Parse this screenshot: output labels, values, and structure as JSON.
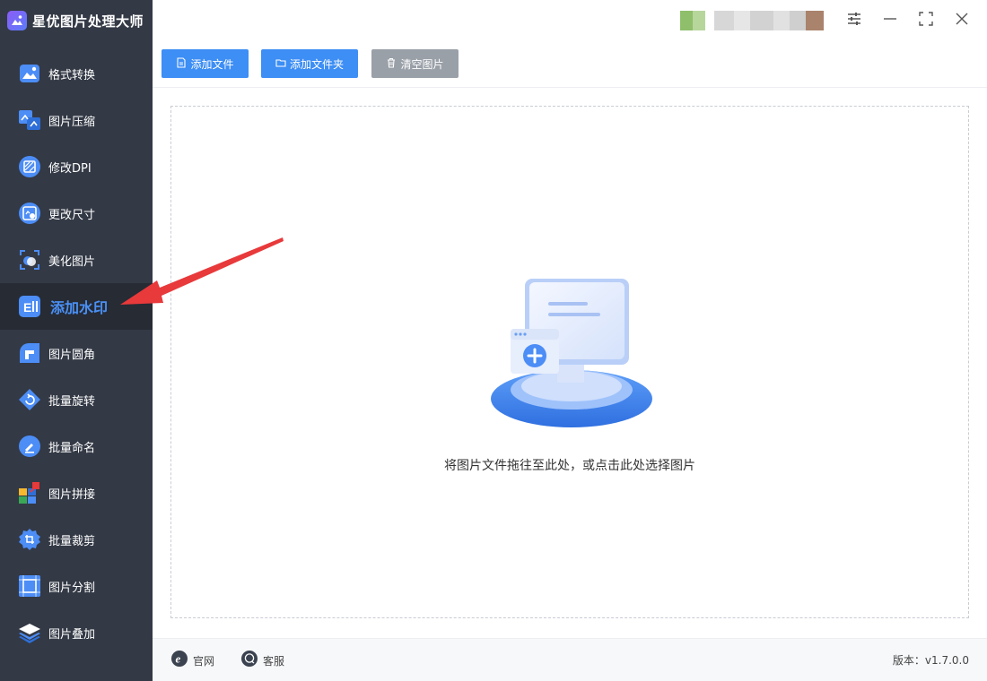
{
  "app": {
    "title": "星优图片处理大师"
  },
  "sidebar": {
    "items": [
      {
        "label": "格式转换",
        "icon": "image-convert-icon",
        "active": false
      },
      {
        "label": "图片压缩",
        "icon": "image-compress-icon",
        "active": false
      },
      {
        "label": "修改DPI",
        "icon": "dpi-icon",
        "active": false
      },
      {
        "label": "更改尺寸",
        "icon": "resize-icon",
        "active": false
      },
      {
        "label": "美化图片",
        "icon": "beautify-icon",
        "active": false
      },
      {
        "label": "添加水印",
        "icon": "watermark-icon",
        "active": true
      },
      {
        "label": "图片圆角",
        "icon": "round-corner-icon",
        "active": false
      },
      {
        "label": "批量旋转",
        "icon": "rotate-icon",
        "active": false
      },
      {
        "label": "批量命名",
        "icon": "rename-icon",
        "active": false
      },
      {
        "label": "图片拼接",
        "icon": "puzzle-icon",
        "active": false
      },
      {
        "label": "批量裁剪",
        "icon": "crop-icon",
        "active": false
      },
      {
        "label": "图片分割",
        "icon": "split-icon",
        "active": false
      },
      {
        "label": "图片叠加",
        "icon": "layers-icon",
        "active": false
      }
    ]
  },
  "toolbar": {
    "add_file": "添加文件",
    "add_folder": "添加文件夹",
    "clear_images": "清空图片"
  },
  "dropzone": {
    "hint": "将图片文件拖往至此处，或点击此处选择图片"
  },
  "footer": {
    "website": "官网",
    "support": "客服",
    "version": "版本：v1.7.0.0"
  },
  "colors": {
    "sidebar_bg": "#333945",
    "sidebar_active_bg": "#262b34",
    "accent": "#3d8ef5",
    "clear_button": "#9aa0a8",
    "annotation_arrow": "#e8393b"
  }
}
